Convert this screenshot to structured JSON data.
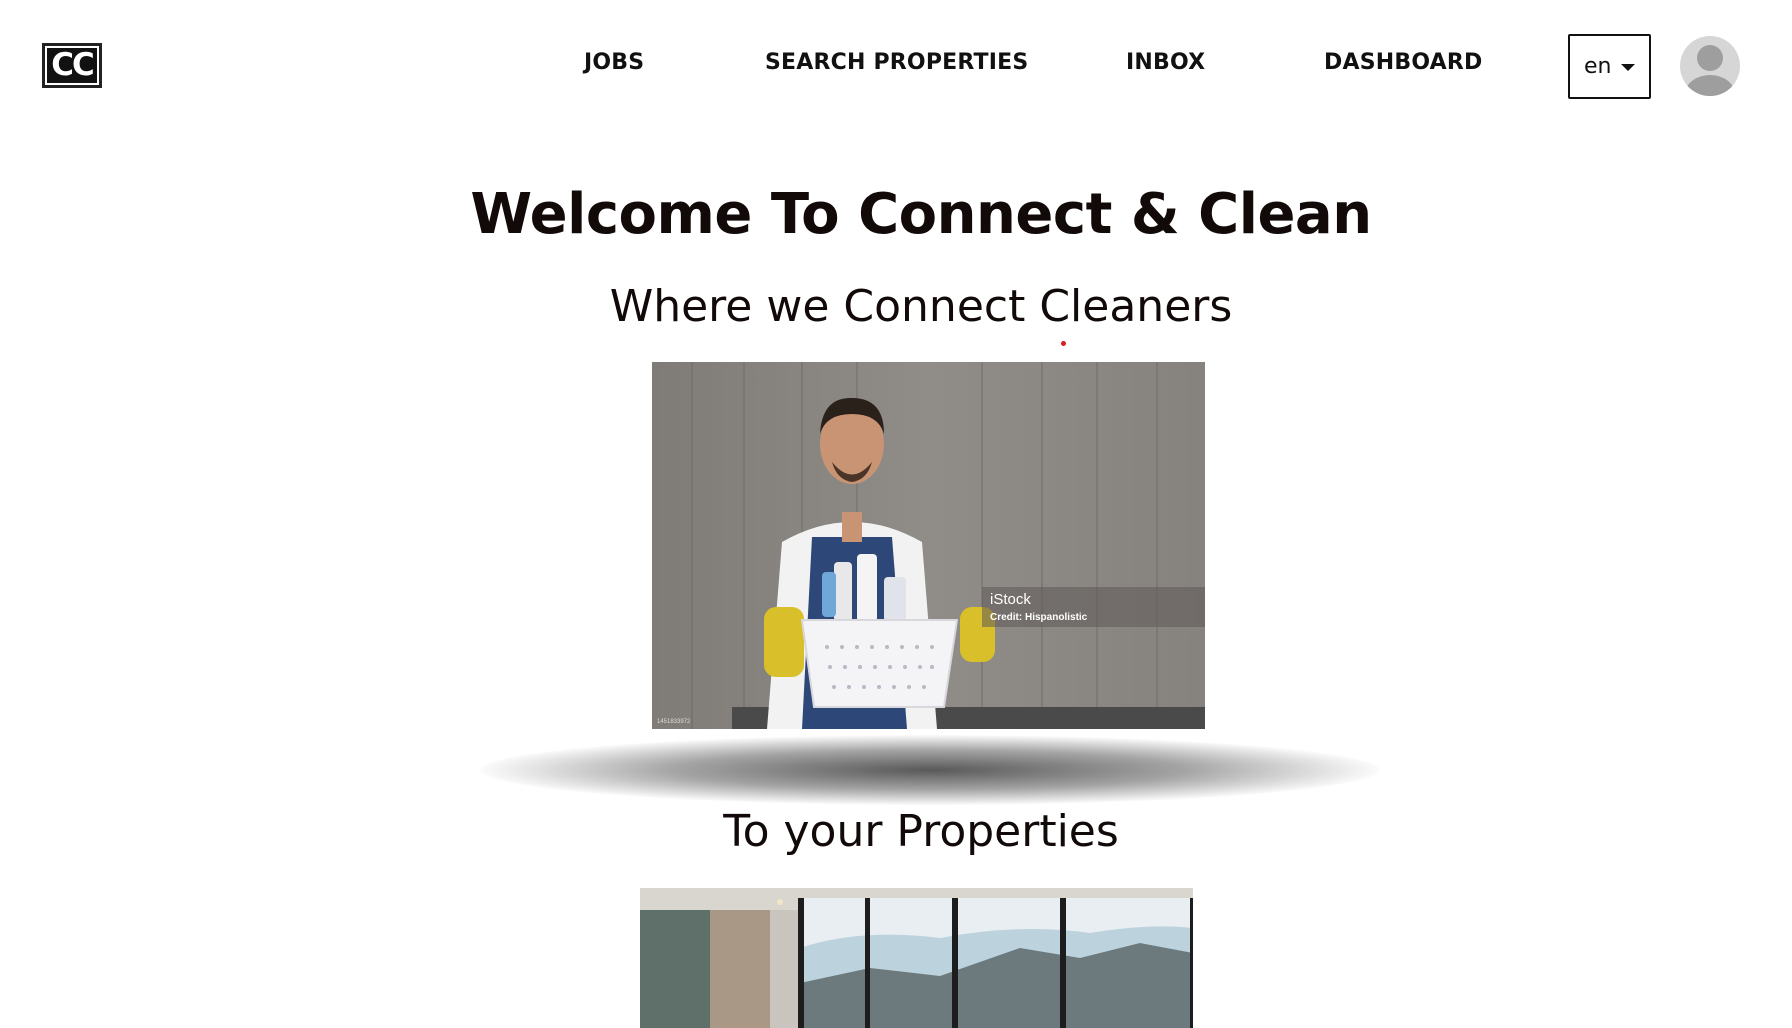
{
  "header": {
    "logo_text": "CC",
    "nav": [
      {
        "label": "JOBS"
      },
      {
        "label": "SEARCH PROPERTIES"
      },
      {
        "label": "INBOX"
      },
      {
        "label": "DASHBOARD"
      }
    ],
    "language": {
      "selected": "en"
    },
    "avatar_icon": "user-avatar-icon"
  },
  "hero": {
    "title": "Welcome To Connect & Clean",
    "subtitle_1": "Where we Connect Cleaners",
    "subtitle_2": "To your Properties",
    "image_1": {
      "watermark_brand": "iStock",
      "watermark_credit": "Credit: Hispanolistic",
      "watermark_id": "1451833972"
    }
  },
  "colors": {
    "text": "#120909",
    "background": "#ffffff",
    "accent_dot": "#d62020"
  }
}
